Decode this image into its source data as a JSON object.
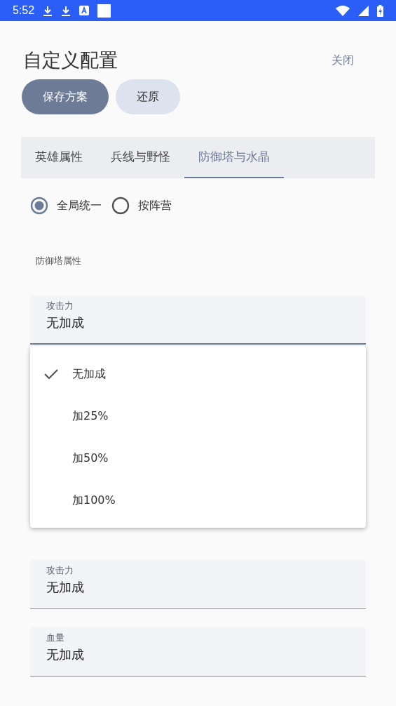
{
  "status_bar": {
    "time": "5:52"
  },
  "title": "自定义配置",
  "close": "关闭",
  "buttons": [
    {
      "label": "保存方案",
      "kind": "primary"
    },
    {
      "label": "还原",
      "kind": "secondary"
    }
  ],
  "tabs": [
    {
      "label": "英雄属性",
      "selected": false
    },
    {
      "label": "兵线与野怪",
      "selected": false
    },
    {
      "label": "防御塔与水晶",
      "selected": true
    }
  ],
  "scope_options": [
    {
      "label": "全局统一",
      "selected": true
    },
    {
      "label": "按阵营",
      "selected": false
    }
  ],
  "tower_section": {
    "title": "防御塔属性",
    "fields": [
      {
        "label": "攻击力",
        "value": "无加成",
        "expanded": true
      }
    ]
  },
  "dropdown": {
    "items": [
      {
        "label": "无加成",
        "selected": true
      },
      {
        "label": "加25%",
        "selected": false
      },
      {
        "label": "加50%",
        "selected": false
      },
      {
        "label": "加100%",
        "selected": false
      }
    ]
  },
  "crystal_section": {
    "fields": [
      {
        "label": "攻击力",
        "value": "无加成",
        "expanded": false
      },
      {
        "label": "血量",
        "value": "无加成",
        "expanded": false
      }
    ]
  }
}
